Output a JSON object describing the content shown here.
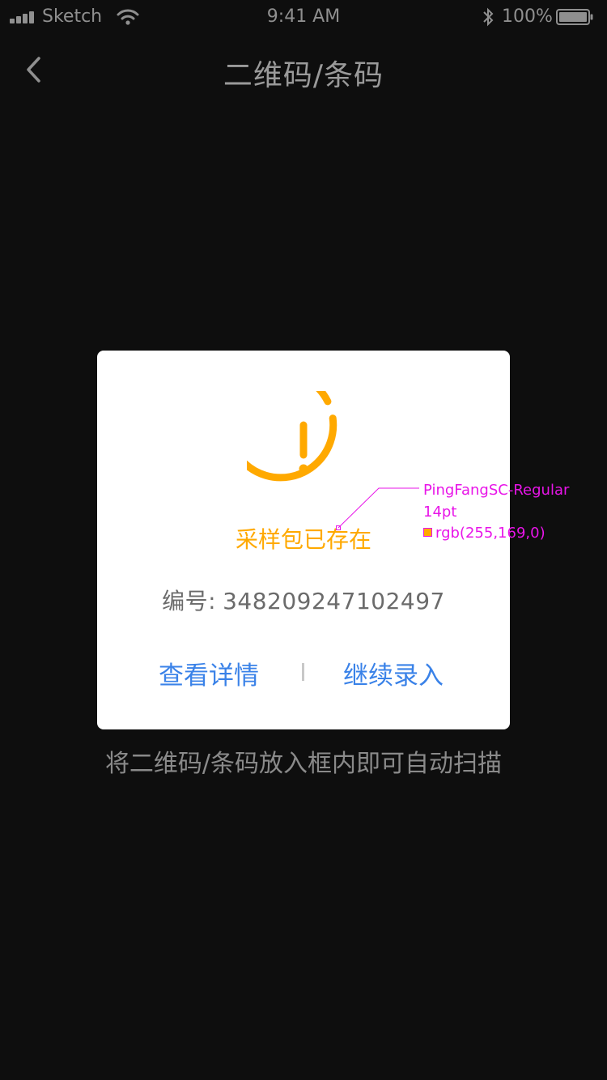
{
  "status_bar": {
    "carrier": "Sketch",
    "time": "9:41 AM",
    "battery": "100%"
  },
  "nav": {
    "title": "二维码/条码"
  },
  "dialog": {
    "title": "采样包已存在",
    "code_label": "编号:",
    "code_value": "348209247102497",
    "view_details": "查看详情",
    "continue_entry": "继续录入"
  },
  "hint": "将二维码/条码放入框内即可自动扫描",
  "annotation": {
    "font": "PingFangSC-Regular",
    "size": "14pt",
    "color_text": "rgb(255,169,0)"
  },
  "colors": {
    "background": "#0e0e0e",
    "dialog": "#ffffff",
    "warning": "#ffa900",
    "action": "#3a82e8",
    "annotation": "#e815e8"
  }
}
